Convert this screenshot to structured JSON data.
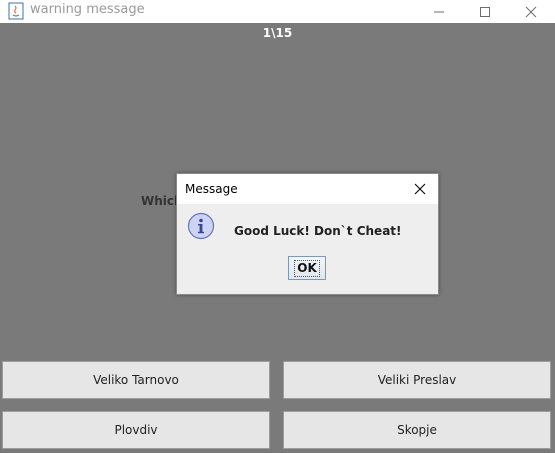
{
  "window": {
    "title": "warning message",
    "app_icon": "java-icon",
    "controls": [
      "minimize-icon",
      "maximize-icon",
      "close-icon"
    ]
  },
  "quiz": {
    "counter": "1\\15",
    "question_visible": "Which",
    "answers": [
      "Veliko Tarnovo",
      "Veliki Preslav",
      "Plovdiv",
      "Skopje"
    ]
  },
  "dialog": {
    "title": "Message",
    "icon": "info-icon",
    "message": "Good Luck! Don`t Cheat!",
    "ok_label": "OK"
  },
  "colors": {
    "overlay_gray": "#7a7a7a",
    "button_bg": "#e6e6e6",
    "dialog_bg": "#eeeeee",
    "info_icon_fill": "#cdd3f2",
    "info_icon_stroke": "#6a74b8"
  }
}
